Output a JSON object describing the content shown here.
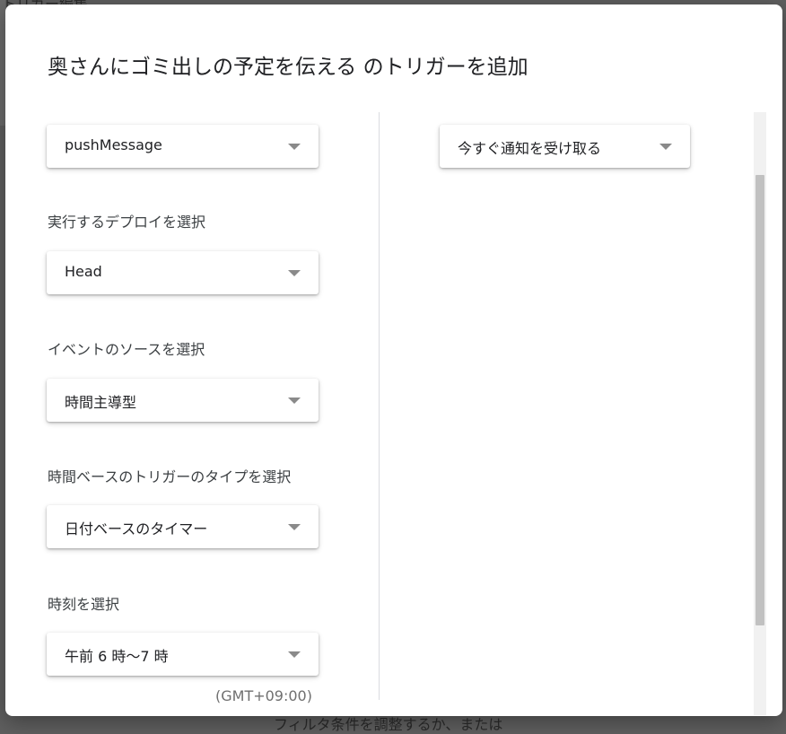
{
  "background": {
    "top_text": "トリガー編集",
    "bottom_text": "フィルタ条件を調整するか、または"
  },
  "dialog": {
    "title": "奥さんにゴミ出しの予定を伝える のトリガーを追加",
    "function_select": {
      "value": "pushMessage"
    },
    "deployment": {
      "label": "実行するデプロイを選択",
      "value": "Head"
    },
    "event_source": {
      "label": "イベントのソースを選択",
      "value": "時間主導型"
    },
    "trigger_type": {
      "label": "時間ベースのトリガーのタイプを選択",
      "value": "日付ベースのタイマー"
    },
    "time": {
      "label": "時刻を選択",
      "value": "午前 6 時～7 時",
      "timezone": "(GMT+09:00)"
    },
    "notification": {
      "value": "今すぐ通知を受け取る"
    }
  },
  "icons": {
    "dropdown": "triangle-down-icon"
  },
  "colors": {
    "overlay": "#5f5f5f",
    "dialog_bg": "#ffffff",
    "divider": "#dadce0",
    "scroll_thumb": "#c1c1c1"
  }
}
